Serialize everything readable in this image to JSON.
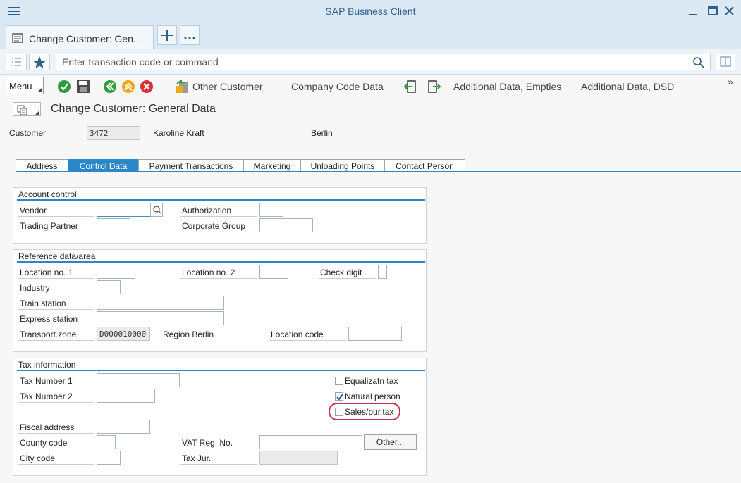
{
  "window": {
    "title": "SAP Business Client"
  },
  "tabs_strip": {
    "active_tab": "Change Customer: Gen..."
  },
  "command": {
    "placeholder": "Enter transaction code or command"
  },
  "toolbar": {
    "menu_label": "Menu",
    "other_customer": "Other Customer",
    "company_code_data": "Company Code Data",
    "additional_empties": "Additional Data, Empties",
    "additional_dsd": "Additional Data, DSD",
    "overflow": "»"
  },
  "page": {
    "title": "Change Customer: General Data"
  },
  "customer": {
    "label": "Customer",
    "number": "3472",
    "name": "Karoline Kraft",
    "city": "Berlin"
  },
  "tabs": [
    "Address",
    "Control Data",
    "Payment Transactions",
    "Marketing",
    "Unloading Points",
    "Contact Person"
  ],
  "account_control": {
    "title": "Account control",
    "vendor": "Vendor",
    "trading_partner": "Trading Partner",
    "authorization": "Authorization",
    "corporate_group": "Corporate Group"
  },
  "reference": {
    "title": "Reference data/area",
    "location_no_1": "Location no. 1",
    "location_no_2": "Location no. 2",
    "check_digit": "Check digit",
    "industry": "Industry",
    "train_station": "Train station",
    "express_station": "Express station",
    "transport_zone": "Transport.zone",
    "transport_zone_value": "D000010000",
    "region_text": "Region Berlin",
    "location_code": "Location code"
  },
  "tax": {
    "title": "Tax information",
    "tax_number_1": "Tax Number 1",
    "tax_number_2": "Tax Number 2",
    "equalization_tax": "Equalizatn tax",
    "natural_person": "Natural person",
    "sales_pur_tax": "Sales/pur.tax",
    "fiscal_address": "Fiscal address",
    "county_code": "County code",
    "city_code": "City code",
    "vat_reg_no": "VAT Reg. No.",
    "other_button": "Other...",
    "tax_jur": "Tax Jur."
  },
  "colors": {
    "accent": "#2b87c9",
    "highlight": "#c8334d"
  }
}
